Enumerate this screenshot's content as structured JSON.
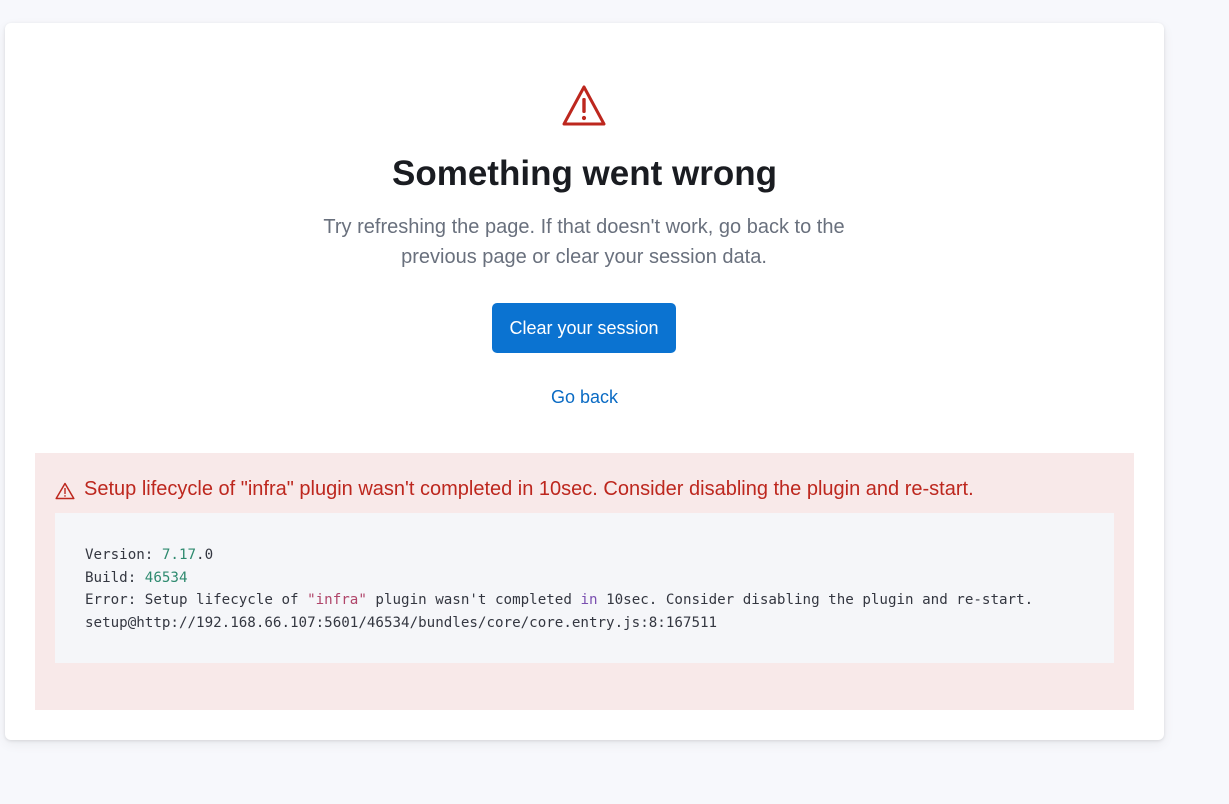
{
  "error_page": {
    "title": "Something went wrong",
    "subtitle": "Try refreshing the page. If that doesn't work, go back to the previous page or clear your session data.",
    "primary_button_label": "Clear your session",
    "back_link_label": "Go back",
    "warning_icon": "warning-triangle-icon"
  },
  "error_details": {
    "message": "Setup lifecycle of \"infra\" plugin wasn't completed in 10sec. Consider disabling the plugin and re-start.",
    "version_label": "Version: ",
    "version_major_minor": "7.17",
    "version_patch": ".0",
    "build_label": "Build: ",
    "build_number": "46534",
    "error_line_prefix": "Error: Setup lifecycle of ",
    "error_line_plugin": "\"infra\"",
    "error_line_mid": " plugin wasn't completed ",
    "error_line_keyword": "in",
    "error_line_suffix": " 10sec. Consider disabling the plugin and re-start.",
    "stack_line": "setup@http://192.168.66.107:5601/46534/bundles/core/core.entry.js:8:167511"
  },
  "colors": {
    "danger": "#bd271e",
    "primary": "#0b73d1",
    "link": "#0a6bc4",
    "error_background": "#f8e9e9"
  }
}
